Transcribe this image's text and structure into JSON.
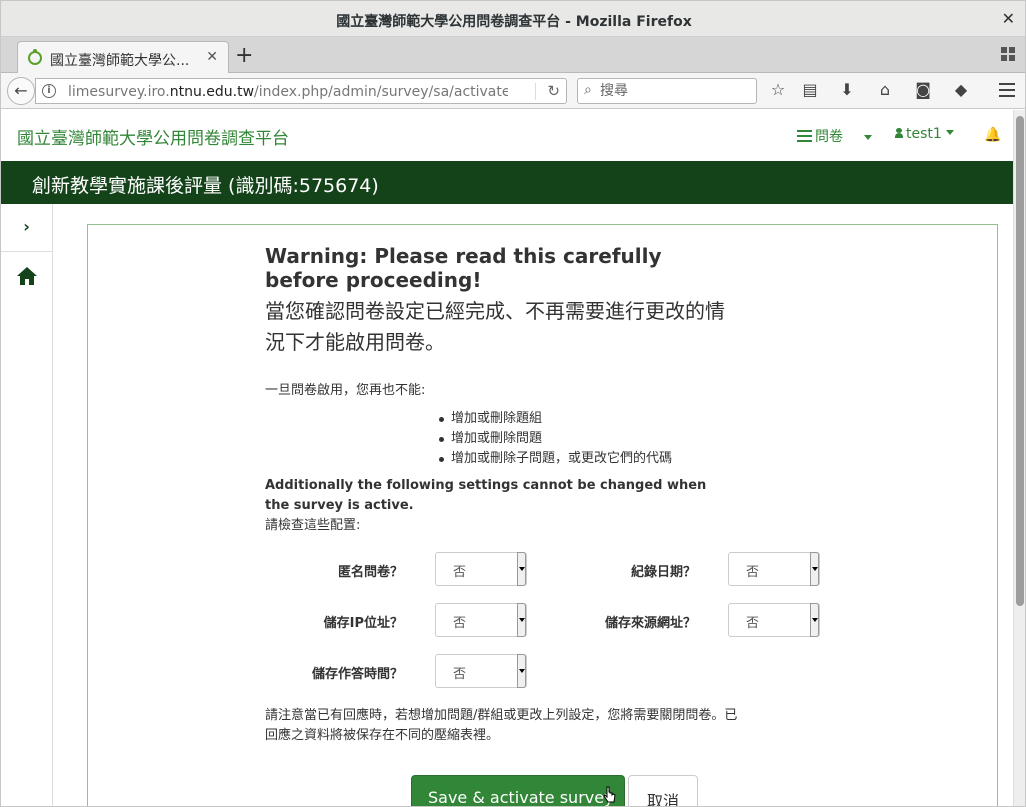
{
  "window": {
    "title": "國立臺灣師範大學公用問卷調查平台 - Mozilla Firefox"
  },
  "tab": {
    "label": "國立臺灣師範大學公..."
  },
  "navbar": {
    "url_prefix": "limesurvey.iro.",
    "url_domain": "ntnu.edu.tw",
    "url_path": "/index.php/admin/survey/sa/activate/surve",
    "search_placeholder": "搜尋"
  },
  "site": {
    "brand": "國立臺灣師範大學公用問卷調查平台",
    "survey_menu": "問卷",
    "user": "test1"
  },
  "survey": {
    "title": "創新教學實施課後評量 (識別碼:575674)"
  },
  "warning": {
    "heading": "Warning: Please read this carefully before proceeding!",
    "subheading": "當您確認問卷設定已經完成、不再需要進行更改的情況下才能啟用問卷。",
    "intro": "一旦問卷啟用，您再也不能:",
    "items": [
      "增加或刪除題組",
      "增加或刪除問題",
      "增加或刪除子問題，或更改它們的代碼"
    ],
    "additional": "Additionally the following settings cannot be changed when the survey is active.",
    "check": "請檢查這些配置:",
    "note": "請注意當已有回應時，若想增加問題/群組或更改上列設定，您將需要關閉問卷。已回應之資料將被保存在不同的壓縮表裡。"
  },
  "settings": {
    "anonymized": {
      "label": "匿名問卷？",
      "value": "否"
    },
    "datestamp": {
      "label": "紀錄日期？",
      "value": "否"
    },
    "ipaddr": {
      "label": "儲存IP位址？",
      "value": "否"
    },
    "refurl": {
      "label": "儲存來源網址？",
      "value": "否"
    },
    "savetimings": {
      "label": "儲存作答時間？",
      "value": "否"
    }
  },
  "buttons": {
    "save": "Save & activate survey",
    "cancel": "取消"
  },
  "colors": {
    "brand": "#328637",
    "header": "#14431a"
  }
}
